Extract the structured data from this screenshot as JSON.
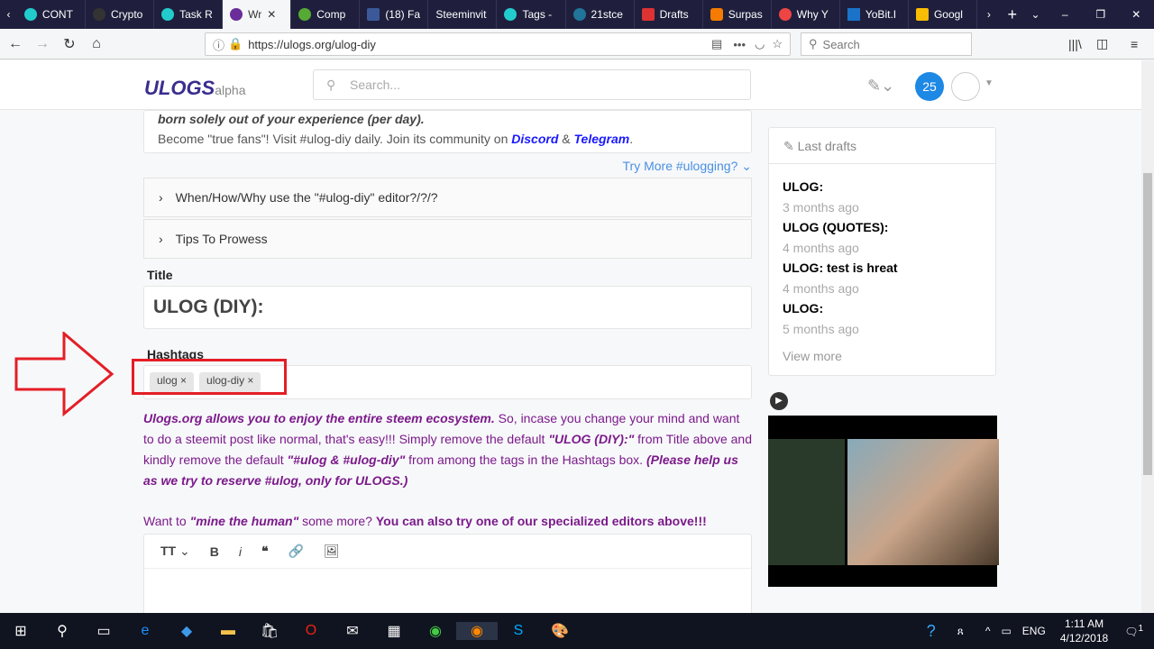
{
  "browser": {
    "tabs": [
      "CONT",
      "Crypto",
      "Task R",
      "Wr",
      "Comp",
      "(18) Fa",
      "Steeminvit",
      "Tags -",
      "21stce",
      "Drafts",
      "Surpas",
      "Why Y",
      "YoBit.I",
      "Googl"
    ],
    "url": "https://ulogs.org/ulog-diy",
    "search_placeholder": "Search"
  },
  "header": {
    "logo": "ULOGS",
    "logo_sub": "alpha",
    "search_placeholder": "Search...",
    "notification_count": "25"
  },
  "intro": {
    "line1": "born solely out of your experience (per day).",
    "line2_prefix": "Become \"true fans\"! Visit #ulog-diy daily. Join its community on ",
    "discord": "Discord",
    "amp": " & ",
    "telegram": "Telegram",
    "end": "."
  },
  "try_more": "Try More #ulogging? ⌄",
  "collapsibles": [
    "When/How/Why use the \"#ulog-diy\" editor?/?/?",
    "Tips To Prowess"
  ],
  "title_label": "Title",
  "title_value": "ULOG (DIY):",
  "hashtags_label": "Hashtags",
  "tags": [
    "ulog",
    "ulog-diy"
  ],
  "notice": {
    "b1": "Ulogs.org allows you to enjoy the entire steem ecosystem.",
    "t1": " So, incase you change your mind and want to do a steemit post like normal, that's easy!!! Simply remove the default ",
    "b2": "\"ULOG (DIY):\"",
    "t2": " from Title above and kindly remove the default ",
    "b3": "\"#ulog & #ulog-diy\"",
    "t3": " from among the tags in the Hashtags box. ",
    "b4": "(Please help us as we try to reserve #ulog, only for ULOGS.)",
    "w1": "Want to ",
    "w2": "\"mine the human\"",
    "w3": " some more? ",
    "w4": "You can also try one of our specialized editors above!!!"
  },
  "drafts": {
    "title": "Last drafts",
    "items": [
      {
        "t": "ULOG:",
        "d": "3 months ago"
      },
      {
        "t": "ULOG (QUOTES):",
        "d": "4 months ago"
      },
      {
        "t": "ULOG: test is hreat",
        "d": "4 months ago"
      },
      {
        "t": "ULOG:",
        "d": "5 months ago"
      }
    ],
    "more": "View more"
  },
  "taskbar": {
    "lang": "ENG",
    "time": "1:11 AM",
    "date": "4/12/2018",
    "notif": "1"
  }
}
